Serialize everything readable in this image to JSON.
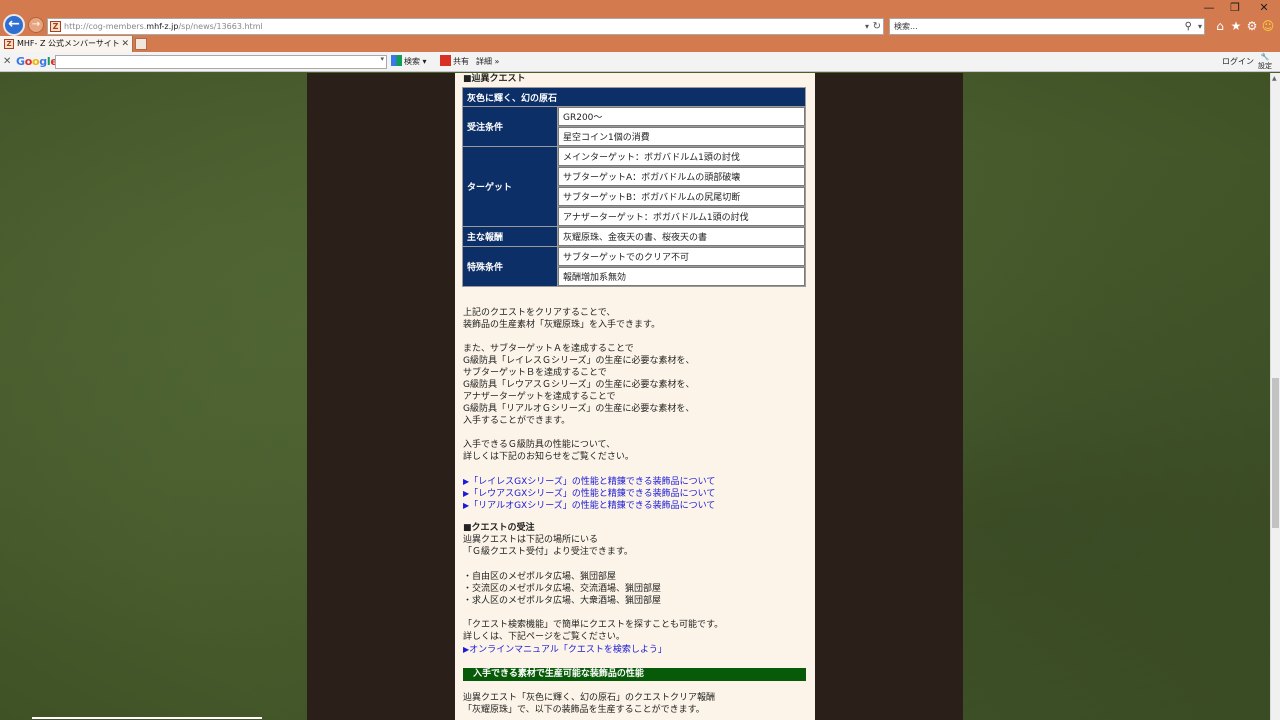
{
  "browser": {
    "url_prefix": "http://cog-members.",
    "url_host": "mhf-z.jp",
    "url_path": "/sp/news/13663.html",
    "search_placeholder": "検索...",
    "tab_title": "MHF- Z 公式メンバーサイト"
  },
  "google_toolbar": {
    "logo": "Google",
    "search_label": "検索",
    "share_label": "共有",
    "more_label": "詳細",
    "login_label": "ログイン",
    "settings_label": "設定"
  },
  "content": {
    "section_title": "■辿異クエスト",
    "table": {
      "title": "灰色に輝く、幻の原石",
      "rows": [
        {
          "label": "受注条件",
          "values": [
            "GR200～",
            "星空コイン1個の消費"
          ]
        },
        {
          "label": "ターゲット",
          "values": [
            "メインターゲット：ボガバドルム1頭の討伐",
            "サブターゲットA：ボガバドルムの頭部破壊",
            "サブターゲットB：ボガバドルムの尻尾切断",
            "アナザーターゲット：ボガバドルム1頭の討伐"
          ]
        },
        {
          "label": "主な報酬",
          "values": [
            "灰耀原珠、金夜天の書、桜夜天の書"
          ]
        },
        {
          "label": "特殊条件",
          "values": [
            "サブターゲットでのクリア不可",
            "報酬増加系無効"
          ]
        }
      ]
    },
    "para1": [
      "上記のクエストをクリアすることで、",
      "装飾品の生産素材「灰耀原珠」を入手できます。"
    ],
    "para2": [
      "また、サブターゲットＡを達成することで",
      "G級防具「レイレスＧシリーズ」の生産に必要な素材を、",
      "サブターゲットＢを達成することで",
      "G級防具「レウアスＧシリーズ」の生産に必要な素材を、",
      "アナザーターゲットを達成することで",
      "G級防具「リアルオＧシリーズ」の生産に必要な素材を、",
      "入手することができます。"
    ],
    "para3": [
      "入手できるＧ級防具の性能について、",
      "詳しくは下記のお知らせをご覧ください。"
    ],
    "links": [
      "「レイレスGXシリーズ」の性能と精錬できる装飾品について",
      "「レウアスGXシリーズ」の性能と精錬できる装飾品について",
      "「リアルオGXシリーズ」の性能と精錬できる装飾品について"
    ],
    "reception_title": "■クエストの受注",
    "reception_text": [
      "辿異クエストは下記の場所にいる",
      "「Ｇ級クエスト受付」より受注できます。"
    ],
    "locations": [
      "・自由区のメゼポルタ広場、猟団部屋",
      "・交流区のメゼポルタ広場、交流酒場、猟団部屋",
      "・求人区のメゼポルタ広場、大衆酒場、猟団部屋"
    ],
    "search_text": [
      "「クエスト検索機能」で簡単にクエストを探すことも可能です。",
      "詳しくは、下記ページをご覧ください。"
    ],
    "manual_link": "オンラインマニュアル「クエストを検索しよう」",
    "banner": "入手できる素材で生産可能な装飾品の性能",
    "final_text": [
      "辿異クエスト「灰色に輝く、幻の原石」のクエストクリア報酬",
      "「灰耀原珠」で、以下の装飾品を生産することができます。"
    ]
  }
}
